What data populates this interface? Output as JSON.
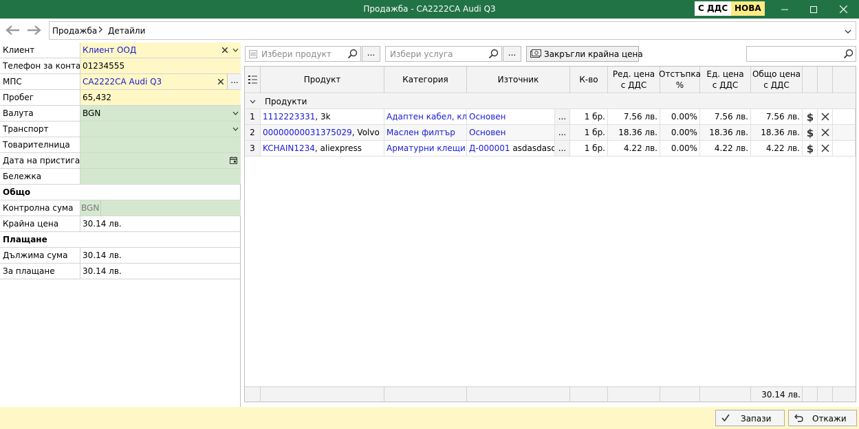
{
  "window": {
    "title": "Продажба - CA2222CA Audi Q3",
    "badge_vat": "С ДДС",
    "badge_new": "НОВА"
  },
  "breadcrumb": {
    "root": "Продажба",
    "current": "Детайли"
  },
  "form": {
    "client_label": "Клиент",
    "client_value": "Клиент ООД",
    "phone_label": "Телефон за контакт",
    "phone_value": "01234555",
    "vehicle_label": "МПС",
    "vehicle_value": "CA2222CA Audi Q3",
    "mileage_label": "Пробег",
    "mileage_value": "65,432",
    "currency_label": "Валута",
    "currency_value": "BGN",
    "transport_label": "Транспорт",
    "waybill_label": "Товарителница",
    "arrival_label": "Дата на пристигане",
    "note_label": "Бележка",
    "general_section": "Общо",
    "checksum_label": "Контролна сума",
    "checksum_currency": "BGN",
    "final_price_label": "Крайна цена",
    "final_price_value": "30.14 лв.",
    "payment_section": "Плащане",
    "due_label": "Дължима сума",
    "due_value": "30.14 лв.",
    "topay_label": "За плащане",
    "topay_value": "30.14 лв."
  },
  "toolbar": {
    "product_placeholder": "Избери продукт",
    "service_placeholder": "Избери услуга",
    "dots": "...",
    "round_button": "Закръгли крайна цена"
  },
  "grid": {
    "headers": {
      "product": "Продукт",
      "category": "Категория",
      "source": "Източник",
      "qty": "К-во",
      "unit_price_l1": "Ред. цена",
      "unit_price_l2": "с ДДС",
      "discount_l1": "Отстъпка",
      "discount_l2": "%",
      "unit_l1": "Ед. цена",
      "unit_l2": "с ДДС",
      "total_l1": "Общо цена",
      "total_l2": "с ДДС"
    },
    "group_label": "Продукти",
    "rows": [
      {
        "num": "1",
        "code": "1112223331",
        "desc": ", 3k",
        "category": "Адаптен кабел, кла...",
        "source": "Основен",
        "source_extra": "",
        "dots": "...",
        "qty": "1 бр.",
        "price": "7.56 лв.",
        "discount": "0.00%",
        "unit": "7.56 лв.",
        "total": "7.56 лв."
      },
      {
        "num": "2",
        "code": "00000000031375029",
        "desc": ", Volvo",
        "category": "Маслен филтър",
        "source": "Основен",
        "source_extra": "",
        "dots": "...",
        "qty": "1 бр.",
        "price": "18.36 лв.",
        "discount": "0.00%",
        "unit": "18.36 лв.",
        "total": "18.36 лв."
      },
      {
        "num": "3",
        "code": "KCHAIN1234",
        "desc": ", aliexpress",
        "category": "Арматурни клещи",
        "source": "Д-000001",
        "source_extra": " asdasdasd",
        "dots": "...",
        "qty": "1 бр.",
        "price": "4.22 лв.",
        "discount": "0.00%",
        "unit": "4.22 лв.",
        "total": "4.22 лв."
      }
    ],
    "footer_total": "30.14 лв."
  },
  "buttons": {
    "save": "Запази",
    "cancel": "Откажи"
  },
  "colors": {
    "title_bar": "#217346",
    "required_field": "#fff8c6",
    "optional_field": "#d4e8cf",
    "link": "#1a1ad6"
  }
}
